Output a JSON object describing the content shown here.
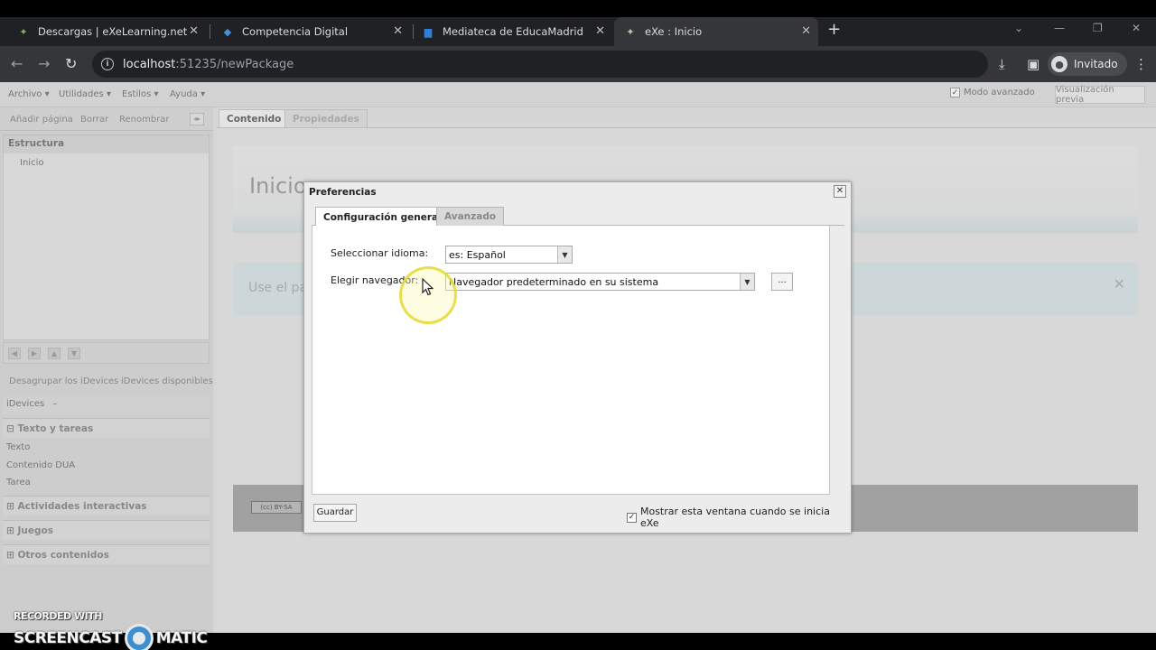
{
  "browser": {
    "tabs": [
      {
        "title": "Descargas | eXeLearning.net",
        "icon": "exe-logo-icon"
      },
      {
        "title": "Competencia Digital",
        "icon": "competencia-digital-icon"
      },
      {
        "title": "Mediateca de EducaMadrid",
        "icon": "mediateca-icon"
      },
      {
        "title": "eXe : Inicio",
        "icon": "exe-logo-icon"
      }
    ],
    "url_host": "localhost",
    "url_path": ":51235/newPackage",
    "profile_label": "Invitado"
  },
  "menubar": {
    "items": [
      "Archivo",
      "Utilidades",
      "Estilos",
      "Ayuda"
    ],
    "advanced_mode_label": "Modo avanzado",
    "advanced_mode_checked": true,
    "preview_label": "Visualización previa"
  },
  "left_panel": {
    "tools": [
      "Añadir página",
      "Borrar",
      "Renombrar"
    ],
    "structure_title": "Estructura",
    "tree_items": [
      "Inicio"
    ],
    "idevice_actions": [
      "Desagrupar los iDevices",
      "iDevices disponibles"
    ],
    "idevices_label": "iDevices",
    "categories": [
      {
        "label": "Texto y tareas",
        "items": [
          "Texto",
          "Contenido DUA",
          "Tarea"
        ]
      },
      {
        "label": "Actividades interactivas",
        "items": []
      },
      {
        "label": "Juegos",
        "items": []
      },
      {
        "label": "Otros contenidos",
        "items": []
      }
    ]
  },
  "content": {
    "tabs": [
      "Contenido",
      "Propiedades"
    ],
    "active_tab": "Contenido",
    "page_title": "Inicio",
    "info_text": "Use el pa",
    "license_badge": "(cc) BY-SA"
  },
  "dialog": {
    "title": "Preferencias",
    "tabs": [
      "Configuración general",
      "Avanzado"
    ],
    "active_tab": "Configuración general",
    "language_label": "Seleccionar idioma:",
    "language_value": "es: Español",
    "browser_label": "Elegir navegador:",
    "browser_value": "Navegador predeterminado en su sistema",
    "browse_button_label": "...",
    "save_label": "Guardar",
    "show_on_start_label": "Mostrar esta ventana cuando se inicia eXe",
    "show_on_start_checked": true
  },
  "watermark": {
    "line1": "RECORDED WITH",
    "line2_left": "SCREENCAST",
    "line2_right": "MATIC"
  },
  "colors": {
    "chrome_dark": "#202124",
    "chrome_toolbar": "#35363a",
    "page_bg": "#d6d6d6",
    "dialog_bg": "#ececec",
    "highlight": "#e6dc3c"
  }
}
